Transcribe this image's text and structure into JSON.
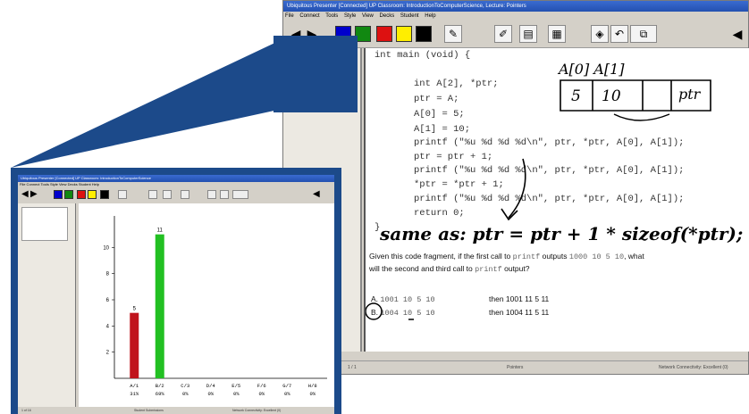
{
  "back_window": {
    "title": "Ubiquitous Presenter   [Connected] UP Classroom: IntroductionToComputerScience, Lecture: Pointers",
    "menu": [
      "File",
      "Connect",
      "Tools",
      "Style",
      "View",
      "Decks",
      "Student",
      "Help"
    ],
    "status": {
      "left": "1 / 1",
      "mid": "Pointers",
      "right": "Network Connectivity: Excellent (0)"
    }
  },
  "slide": {
    "code_lines": [
      "int main (void) {",
      "int A[2], *ptr;",
      "ptr = A;",
      "A[0] = 5;",
      "A[1] = 10;",
      "printf (\"%u %d %d %d\\n\", ptr, *ptr, A[0], A[1]);",
      "ptr = ptr + 1;",
      "printf (\"%u %d %d %d\\n\", ptr, *ptr, A[0], A[1]);",
      "*ptr = *ptr + 1;",
      "printf (\"%u %d %d %d\\n\", ptr, *ptr, A[0], A[1]);",
      "return 0;",
      "}"
    ],
    "ink": {
      "array_labels": "A[0] A[1]",
      "cell_0": "5",
      "cell_1": "10",
      "cell_ptr": "ptr",
      "note": "same as: ptr = ptr + 1 * sizeof(*ptr);"
    },
    "question": {
      "part1": "Given this code fragment, if the first call to ",
      "code1": "printf",
      "part2": " outputs ",
      "code2": "1000  10 5 10",
      "part3": ", what",
      "line2a": "will the second and third call to ",
      "code3": "printf",
      "line2b": " output?"
    },
    "answers": [
      {
        "letter": "A.",
        "a": "1001 10 5 10",
        "b": "then 1001 11 5 11"
      },
      {
        "letter": "B.",
        "a": "1004 10 5 10",
        "b": "then 1004 11 5 11"
      }
    ]
  },
  "front_window": {
    "title": "Ubiquitous Presenter   [Connected] UP Classroom: IntroductionToComputerScience",
    "menu": "File  Connect  Tools  Style  View  Decks  Student  Help",
    "status_left": "1 of 16",
    "status_mid": "Student Submissions",
    "status_right": "Network Connectivity: Excellent (0)"
  },
  "colors": {
    "frame_blue": "#1c4a8a",
    "bar_red": "#c0141c",
    "bar_green": "#22c022",
    "palette": [
      "#0000cc",
      "#118811",
      "#dd1111",
      "#ffee00",
      "#000000"
    ]
  },
  "chart_data": {
    "type": "bar",
    "categories": [
      "A/1",
      "B/2",
      "C/3",
      "D/4",
      "E/5",
      "F/6",
      "G/7",
      "H/8"
    ],
    "values": [
      5,
      11,
      0,
      0,
      0,
      0,
      0,
      0
    ],
    "percent_labels": [
      "31%",
      "69%",
      "0%",
      "0%",
      "0%",
      "0%",
      "0%",
      "0%"
    ],
    "value_labels": [
      "5",
      "11",
      "",
      "",
      "",
      "",
      "",
      ""
    ],
    "yticks": [
      2,
      4,
      6,
      8,
      10
    ],
    "ylim": [
      0,
      12
    ],
    "bar_colors": [
      "#c0141c",
      "#22c022",
      "",
      "",
      "",
      "",
      "",
      ""
    ],
    "grid": false
  }
}
